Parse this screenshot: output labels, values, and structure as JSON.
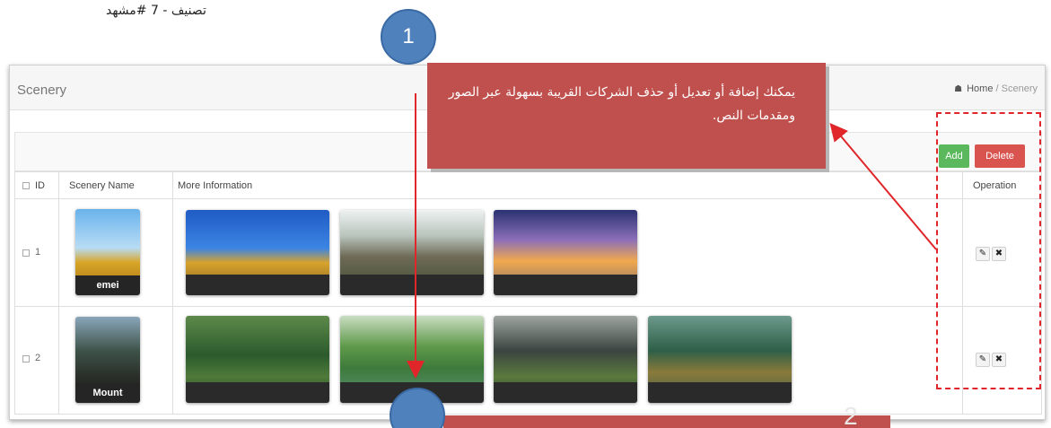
{
  "doc_caption": "تصنيف - 7 #مشهد",
  "page": {
    "title": "Scenery",
    "breadcrumb": {
      "home": "Home",
      "separator": "/",
      "current": "Scenery"
    }
  },
  "toolbar": {
    "add_label": "Add",
    "delete_label": "Delete"
  },
  "table": {
    "columns": {
      "id": "ID",
      "name": "Scenery Name",
      "info": "More Information",
      "operation": "Operation"
    },
    "rows": [
      {
        "id": "1",
        "name": "emei",
        "info_images": [
          "golden-buddha-statues",
          "cliff-waterfall",
          "temple-at-sunset"
        ]
      },
      {
        "id": "2",
        "name": "Mount",
        "info_images": [
          "temple-in-forest",
          "green-mountains-lake",
          "pagoda-roofs",
          "boat-on-lake"
        ]
      }
    ],
    "operation_icons": [
      "pencil-icon",
      "close-icon"
    ]
  },
  "callout": {
    "text": "يمكنك إضافة أو تعديل أو حذف الشركات القريبة بسهولة عبر الصور ومقدمات النص."
  },
  "markers": [
    "1",
    "2"
  ],
  "colors": {
    "callout": "#c0504d",
    "marker": "#4f81bd",
    "add": "#5cb85c",
    "delete": "#d9534f",
    "annotation_red": "#e0262a"
  }
}
